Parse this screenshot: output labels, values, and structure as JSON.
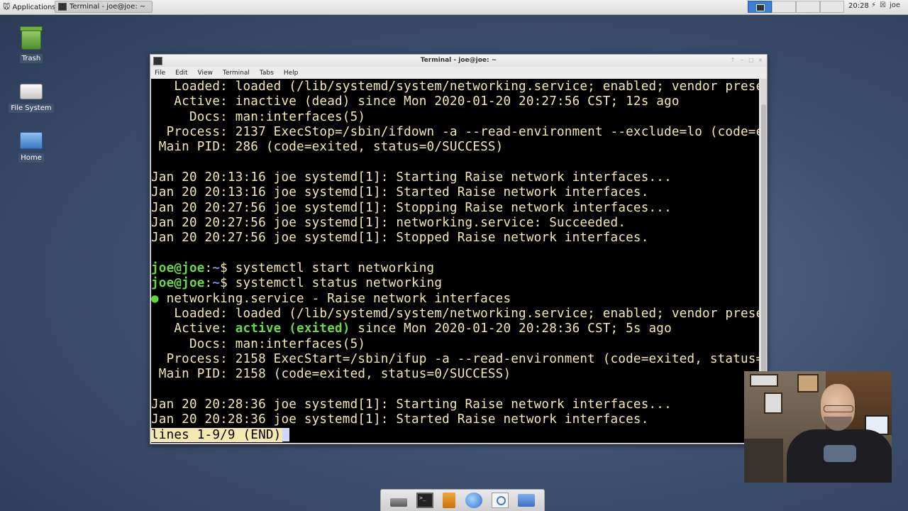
{
  "top_panel": {
    "applications_label": "Applications",
    "task_title": "Terminal - joe@joe: ~",
    "clock": "20:28",
    "user": "joe"
  },
  "desktop": {
    "icons": [
      {
        "label": "Trash"
      },
      {
        "label": "File System"
      },
      {
        "label": "Home"
      }
    ]
  },
  "window": {
    "title": "Terminal - joe@joe: ~",
    "controls": [
      "↑",
      "–",
      "□",
      "×"
    ],
    "menu": [
      "File",
      "Edit",
      "View",
      "Terminal",
      "Tabs",
      "Help"
    ]
  },
  "terminal": {
    "lines": [
      "   Loaded: loaded (/lib/systemd/system/networking.service; enabled; vendor prese",
      "   Active: inactive (dead) since Mon 2020-01-20 20:27:56 CST; 12s ago",
      "     Docs: man:interfaces(5)",
      "  Process: 2137 ExecStop=/sbin/ifdown -a --read-environment --exclude=lo (code=e",
      " Main PID: 286 (code=exited, status=0/SUCCESS)",
      "",
      "Jan 20 20:13:16 joe systemd[1]: Starting Raise network interfaces...",
      "Jan 20 20:13:16 joe systemd[1]: Started Raise network interfaces.",
      "Jan 20 20:27:56 joe systemd[1]: Stopping Raise network interfaces...",
      "Jan 20 20:27:56 joe systemd[1]: networking.service: Succeeded.",
      "Jan 20 20:27:56 joe systemd[1]: Stopped Raise network interfaces.",
      ""
    ],
    "prompt_user": "joe@joe",
    "prompt_sep": ":",
    "prompt_path": "~",
    "prompt_symbol": "$ ",
    "cmd1": "systemctl start networking",
    "cmd2": "systemctl status networking",
    "status_dot": "●",
    "service_line": " networking.service - Raise network interfaces",
    "loaded_line": "   Loaded: loaded (/lib/systemd/system/networking.service; enabled; vendor prese",
    "active_prefix": "   Active: ",
    "active_state": "active (exited)",
    "active_suffix": " since Mon 2020-01-20 20:28:36 CST; 5s ago",
    "lines2": [
      "     Docs: man:interfaces(5)",
      "  Process: 2158 ExecStart=/sbin/ifup -a --read-environment (code=exited, status=",
      " Main PID: 2158 (code=exited, status=0/SUCCESS)",
      "",
      "Jan 20 20:28:36 joe systemd[1]: Starting Raise network interfaces...",
      "Jan 20 20:28:36 joe systemd[1]: Started Raise network interfaces."
    ],
    "pager_status": "lines 1-9/9 (END)"
  },
  "dock": {
    "items": [
      "show-desktop-icon",
      "terminal-icon",
      "file-manager-icon",
      "web-browser-icon",
      "app-finder-icon",
      "folder-icon"
    ]
  }
}
